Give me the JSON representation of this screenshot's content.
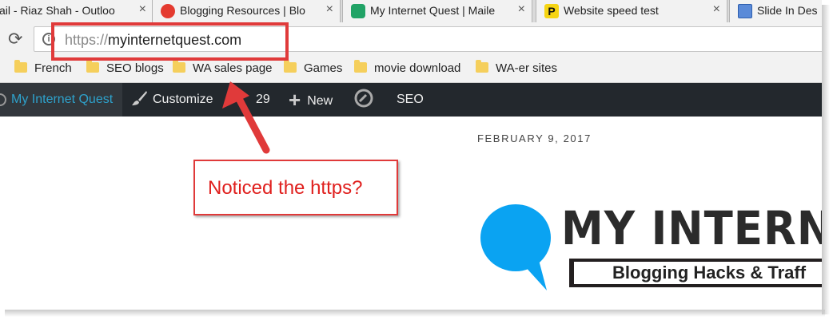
{
  "tabs": [
    {
      "title": "ail - Riaz Shah - Outloo",
      "close": "×",
      "favicon": "none"
    },
    {
      "title": "Blogging Resources | Blo",
      "close": "×",
      "favicon": "red-circle"
    },
    {
      "title": "My Internet Quest | Maile",
      "close": "×",
      "favicon": "green-speech"
    },
    {
      "title": "Website speed test",
      "close": "×",
      "favicon": "yellow-p",
      "favicon_glyph": "P"
    },
    {
      "title": "Slide In Des",
      "favicon": "calendar-icon"
    }
  ],
  "toolbar": {
    "reload_glyph": "⟳",
    "info_glyph": "i",
    "url_scheme": "https://",
    "url_host": "myinternetquest.com"
  },
  "bookmarks": [
    {
      "label": "French"
    },
    {
      "label": "SEO blogs"
    },
    {
      "label": "WA sales page"
    },
    {
      "label": "Games"
    },
    {
      "label": "movie download"
    },
    {
      "label": "WA-er sites"
    }
  ],
  "adminbar": {
    "site_name": "My Internet Quest",
    "customize": "Customize",
    "updates_count": "29",
    "new_label": "New",
    "new_glyph": "+",
    "seo": "SEO",
    "colors": {
      "bg": "#23282d",
      "site": "#2ea2cc"
    }
  },
  "page": {
    "date": "FEBRUARY 9, 2017",
    "logo_title": "MY INTERNET Q",
    "logo_tagline": "Blogging Hacks & Traff",
    "logo_bubble_color": "#0aa3f2"
  },
  "annotation": {
    "callout_text": "Noticed the https?",
    "color": "#e03a3a"
  }
}
